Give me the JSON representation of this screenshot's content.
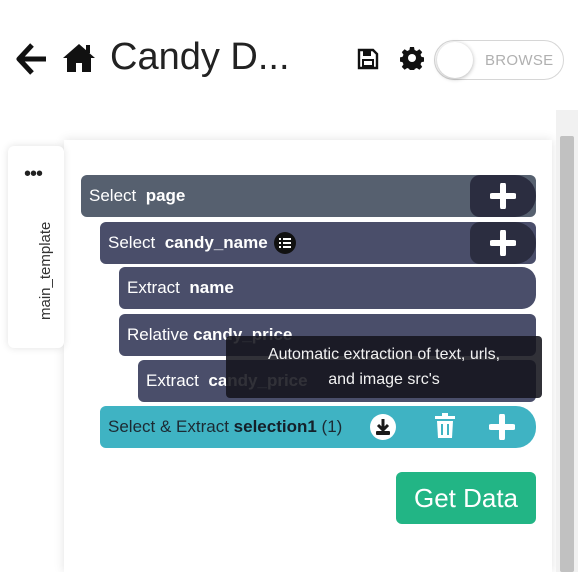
{
  "header": {
    "title": "Candy D...",
    "back_icon": "arrow-left-icon",
    "home_icon": "home-icon",
    "save_icon": "floppy-disk-icon",
    "settings_icon": "gear-icon",
    "mode_toggle_label": "BROWSE"
  },
  "side_tab": {
    "menu_icon": "more-dots-icon",
    "template_label": "main_template"
  },
  "rows": {
    "page": {
      "keyword": "Select  ",
      "name": "page"
    },
    "candy_name": {
      "keyword": "Select  ",
      "name": "candy_name"
    },
    "extract_name": {
      "keyword": "Extract  ",
      "name": "name"
    },
    "relative": {
      "keyword": "Relative ",
      "name": "candy_price"
    },
    "extract_price": {
      "keyword": "Extract  ",
      "name": "candy_price"
    },
    "selection": {
      "keyword": "Select & Extract ",
      "name": "selection1",
      "count": " (1)"
    }
  },
  "tooltip": {
    "line1": "Automatic extraction of text, urls,",
    "line2": "and image src's"
  },
  "actions": {
    "get_data_label": "Get Data"
  },
  "colors": {
    "row_dark": "#4a4e6a",
    "row_page": "#56606f",
    "row_selection": "#3fb3c3",
    "plus_cap": "#2b2d40",
    "get_data": "#22b585"
  }
}
